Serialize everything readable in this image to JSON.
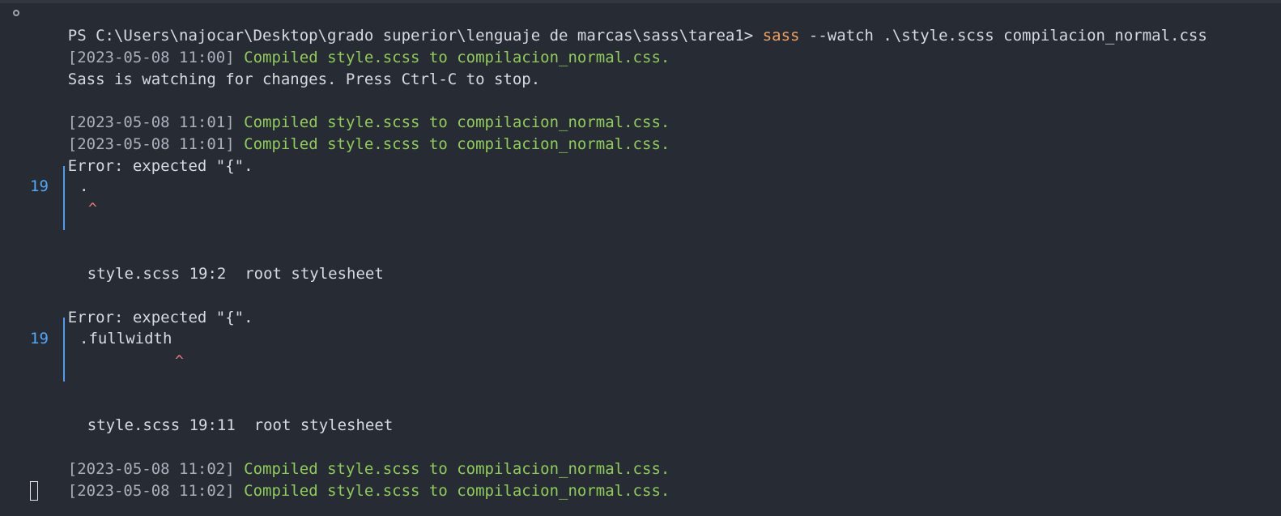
{
  "prompt": {
    "path": "PS C:\\Users\\najocar\\Desktop\\grado superior\\lenguaje de marcas\\sass\\tarea1>",
    "command": "sass",
    "arguments": "--watch .\\style.scss compilacion_normal.css"
  },
  "lines": {
    "line1_ts": "[2023-05-08 11:00]",
    "line1_msg": "Compiled style.scss to compilacion_normal.css.",
    "watching": "Sass is watching for changes. Press Ctrl-C to stop.",
    "line3_ts": "[2023-05-08 11:01]",
    "line3_msg": "Compiled style.scss to compilacion_normal.css.",
    "line4_ts": "[2023-05-08 11:01]",
    "line4_msg": "Compiled style.scss to compilacion_normal.css.",
    "error1": "Error: expected \"{\".",
    "error1_lineno": "19",
    "error1_code": ".",
    "error1_caret": "^",
    "error1_location": "style.scss 19:2  root stylesheet",
    "error2": "Error: expected \"{\".",
    "error2_lineno": "19",
    "error2_code": ".fullwidth",
    "error2_caret": "^",
    "error2_location": "style.scss 19:11  root stylesheet",
    "line5_ts": "[2023-05-08 11:02]",
    "line5_msg": "Compiled style.scss to compilacion_normal.css.",
    "line6_ts": "[2023-05-08 11:02]",
    "line6_msg": "Compiled style.scss to compilacion_normal.css."
  },
  "colors": {
    "background": "#272b33",
    "success": "#8fcc5a",
    "command": "#f2a15f",
    "line_number": "#53a7f5",
    "caret": "#ee7b7b"
  }
}
